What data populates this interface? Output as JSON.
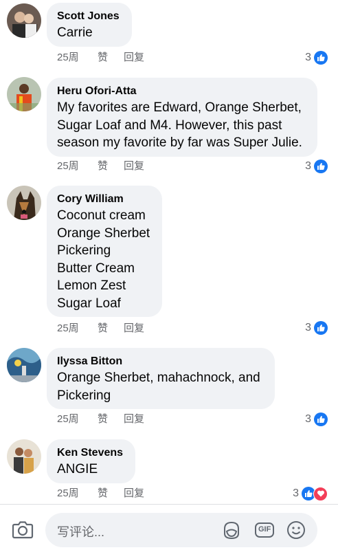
{
  "comments": [
    {
      "author": "Scott Jones",
      "text": "Carrie",
      "time": "25周",
      "like": "赞",
      "reply": "回复",
      "reactions": "3"
    },
    {
      "author": "Heru Ofori-Atta",
      "text": "My favorites are Edward, Orange Sherbet, Sugar Loaf and M4. However, this past season my favorite by far was Super Julie.",
      "time": "25周",
      "like": "赞",
      "reply": "回复",
      "reactions": "3"
    },
    {
      "author": "Cory William",
      "lines": [
        "Coconut cream",
        "Orange Sherbet",
        "Pickering",
        "Butter Cream",
        "Lemon Zest",
        "Sugar Loaf"
      ],
      "time": "25周",
      "like": "赞",
      "reply": "回复",
      "reactions": "3"
    },
    {
      "author": "Ilyssa Bitton",
      "text": "Orange Sherbet, mahachnock, and Pickering",
      "time": "25周",
      "like": "赞",
      "reply": "回复",
      "reactions": "3"
    },
    {
      "author": "Ken Stevens",
      "text": "ANGIE",
      "time": "25周",
      "like": "赞",
      "reply": "回复",
      "reactions": "3"
    }
  ],
  "composer": {
    "placeholder": "写评论...",
    "gif_label": "GIF"
  },
  "colors": {
    "like": "#1877f2",
    "heart": "#f33e58",
    "bubble": "#f0f2f5",
    "meta": "#65676b"
  }
}
